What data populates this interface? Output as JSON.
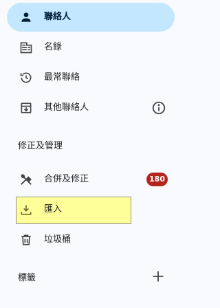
{
  "nav": {
    "contacts": "聯絡人",
    "directory": "名錄",
    "frequent": "最常聯絡",
    "other_contacts": "其他聯絡人"
  },
  "fix_manage": {
    "header": "修正及管理",
    "merge_fix": "合併及修正",
    "merge_fix_count": "180",
    "import": "匯入",
    "trash": "垃圾桶"
  },
  "labels": {
    "header": "標籤"
  },
  "colors": {
    "active_background": "#c2e7ff",
    "badge_background": "#b3261e",
    "highlight": "#ffff9a",
    "icon": "#444746"
  },
  "icons": {
    "contacts": "person-icon",
    "directory": "building-icon",
    "frequent": "history-icon",
    "other_contacts": "archive-download-icon",
    "other_contacts_info": "info-icon",
    "merge_fix": "tools-icon",
    "import": "download-icon",
    "trash": "trash-icon",
    "labels_add": "plus-icon"
  }
}
